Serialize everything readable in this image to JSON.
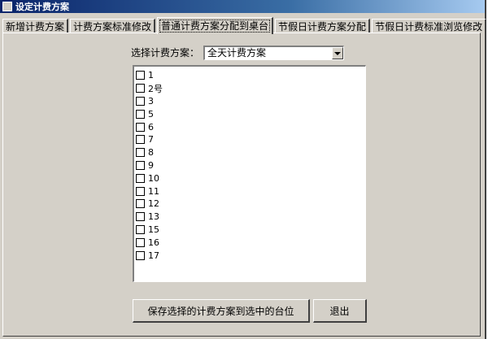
{
  "window": {
    "title": "设定计费方案"
  },
  "tabs": [
    {
      "label": "新增计费方案"
    },
    {
      "label": "计费方案标准修改"
    },
    {
      "label": "普通计费方案分配到桌台"
    },
    {
      "label": "节假日计费方案分配"
    },
    {
      "label": "节假日计费标准浏览修改"
    }
  ],
  "scheme": {
    "label": "选择计费方案：",
    "selected": "全天计费方案"
  },
  "tables": [
    {
      "label": "1"
    },
    {
      "label": "2号"
    },
    {
      "label": "3"
    },
    {
      "label": "5"
    },
    {
      "label": "6"
    },
    {
      "label": "7"
    },
    {
      "label": "8"
    },
    {
      "label": "9"
    },
    {
      "label": "10"
    },
    {
      "label": "11"
    },
    {
      "label": "12"
    },
    {
      "label": "13"
    },
    {
      "label": "15"
    },
    {
      "label": "16"
    },
    {
      "label": "17"
    }
  ],
  "buttons": {
    "save": "保存选择的计费方案到选中的台位",
    "exit": "退出"
  }
}
